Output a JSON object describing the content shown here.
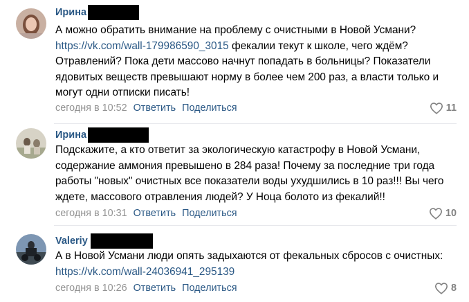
{
  "comments": [
    {
      "author": "Ирина",
      "text_before": "А можно обратить внимание на проблему с очистными в Новой Усмани?\n",
      "link": "https://vk.com/wall-179986590_3015",
      "text_after": " фекалии текут к школе, чего ждём? Отравлений? Пока дети массово начнут попадать в больницы? Показатели ядовитых веществ превышают норму в более чем 200 раз, а власти только и могут одни отписки писать!",
      "date": "сегодня в 10:52",
      "reply": "Ответить",
      "share": "Поделиться",
      "likes": "11"
    },
    {
      "author": "Ирина",
      "text_before": "Подскажите, а кто ответит за экологическую катастрофу в Новой Усмани, содержание аммония превышено в 284 раза! Почему за последние три года работы \"новых\" очистных все показатели воды ухудшились в 10 раз!!! Вы чего ждете, массового отравления людей? У Ноца болото из фекалий!!",
      "link": "",
      "text_after": "",
      "date": "сегодня в 10:31",
      "reply": "Ответить",
      "share": "Поделиться",
      "likes": "10"
    },
    {
      "author": "Valeriy",
      "text_before": "А в Новой Усмани люди опять задыхаются от фекальных сбросов с очистных: ",
      "link": "https://vk.com/wall-24036941_295139",
      "text_after": "",
      "date": "сегодня в 10:26",
      "reply": "Ответить",
      "share": "Поделиться",
      "likes": "8"
    }
  ],
  "colors": {
    "link": "#2a5885",
    "meta": "#939393",
    "like": "#828282",
    "divider": "#e7e8ec"
  },
  "icons": {
    "like": "heart-outline-icon"
  }
}
